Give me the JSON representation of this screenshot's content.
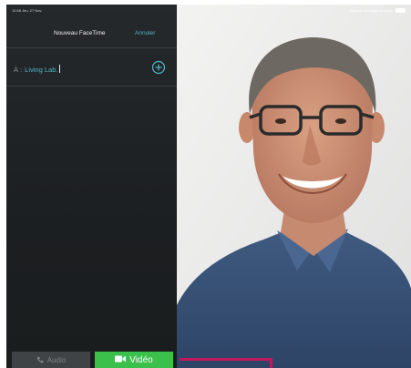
{
  "status": {
    "left_text": "10:58 Jeu. 27 Nov.",
    "right_text": "Aucune recharge en cours"
  },
  "nav": {
    "title": "Nouveau FaceTime",
    "cancel_label": "Annuler"
  },
  "recipient": {
    "prefix": "À :",
    "value": "Living Lab."
  },
  "actions": {
    "audio_label": "Audio",
    "video_label": "Vidéo"
  },
  "colors": {
    "accent": "#4fb6c8",
    "video_button": "#3cc04c",
    "annotation": "#c2185b"
  },
  "icons": {
    "add": "plus-circle-icon",
    "phone": "phone-icon",
    "camera": "video-camera-icon",
    "battery": "battery-icon"
  }
}
